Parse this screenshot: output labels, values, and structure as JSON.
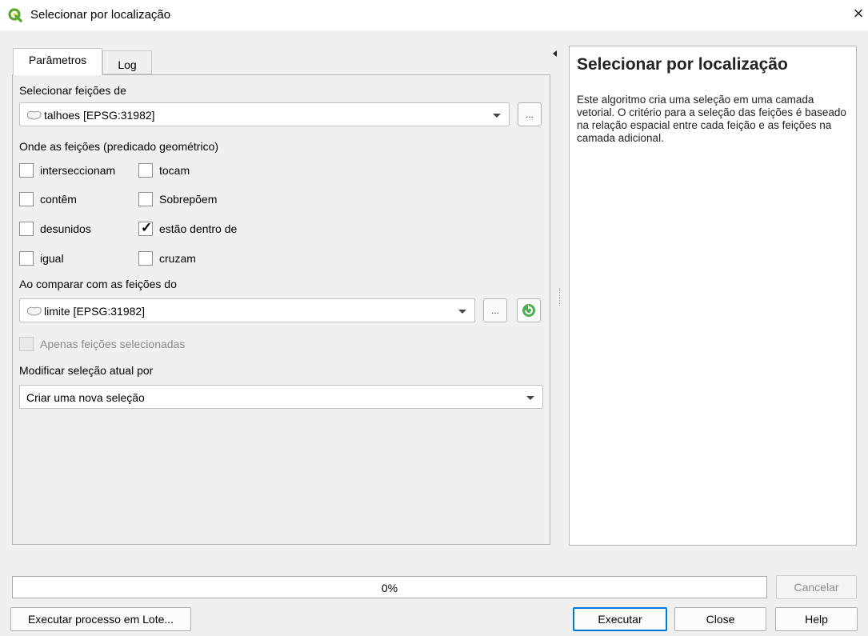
{
  "window": {
    "title": "Selecionar por localização",
    "close_glyph": "×",
    "accent": "#5aa832"
  },
  "tabs": [
    {
      "label": "Parâmetros",
      "active": true
    },
    {
      "label": "Log",
      "active": false
    }
  ],
  "params": {
    "select_from_label": "Selecionar feições de",
    "select_from_value": "talhoes [EPSG:31982]",
    "predicate_label": "Onde as feições (predicado geométrico)",
    "predicates": [
      {
        "label": "interseccionam",
        "checked": false
      },
      {
        "label": "tocam",
        "checked": false
      },
      {
        "label": "contêm",
        "checked": false
      },
      {
        "label": "Sobrepõem",
        "checked": false
      },
      {
        "label": "desunidos",
        "checked": false
      },
      {
        "label": "estão dentro de",
        "checked": true
      },
      {
        "label": "igual",
        "checked": false
      },
      {
        "label": "cruzam",
        "checked": false
      }
    ],
    "compare_label": "Ao comparar com as feições do",
    "compare_value": "limite [EPSG:31982]",
    "selected_only_label": "Apenas feições selecionadas",
    "modify_label": "Modificar seleção atual por",
    "modify_value": "Criar uma nova seleção",
    "dots": "..."
  },
  "help": {
    "title": "Selecionar por localização",
    "body": "Este algoritmo cria uma seleção em uma camada vetorial. O critério para a seleção das feições é baseado na relação espacial entre cada feição e as feições na camada adicional."
  },
  "progress": {
    "text": "0%",
    "value": 0
  },
  "buttons": {
    "cancel": "Cancelar",
    "batch": "Executar processo em Lote...",
    "run": "Executar",
    "close": "Close",
    "help": "Help"
  }
}
